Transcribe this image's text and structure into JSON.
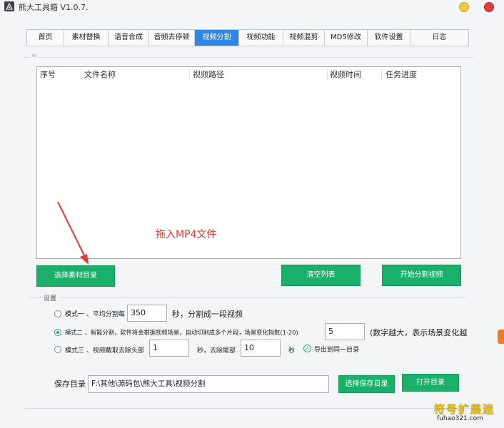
{
  "window": {
    "title": "熊大工具箱 V1.0.7.",
    "min_color": "#f4c542",
    "close_color": "#e23b3b"
  },
  "tabs": [
    {
      "label": "首页"
    },
    {
      "label": "素材替换"
    },
    {
      "label": "语音合成"
    },
    {
      "label": "音频去停顿"
    },
    {
      "label": "视频分割",
      "active": true
    },
    {
      "label": "视频功能"
    },
    {
      "label": "视频混剪"
    },
    {
      "label": "MD5修改"
    },
    {
      "label": "软件设置"
    },
    {
      "label": "日志"
    }
  ],
  "file_group_label": "45",
  "file_list": {
    "columns": [
      "序号",
      "文件名称",
      "视频路径",
      "视频时间",
      "任务进度"
    ],
    "rows": [],
    "drop_hint": "拖入MP4文件"
  },
  "actions": {
    "select_dir": "选择素材目录",
    "clear_list": "清空列表",
    "start_split": "开始分割视频"
  },
  "settings": {
    "label": "设置",
    "mode1": {
      "label": "模式一 、平均分割每",
      "value": "350",
      "suffix": "秒，分割成一段视频",
      "checked": false
    },
    "mode2": {
      "label": "模式二 、智能分割，软件将会根据视频场景，自动切割成多个片段，场景变化指数(1-20)",
      "value": "5",
      "suffix": "(数字越大，表示场景变化越",
      "checked": true
    },
    "mode3": {
      "label": "模式三 、视频截取去除头部",
      "head_value": "1",
      "mid": "秒，去除尾部",
      "tail_value": "10",
      "sec": "秒",
      "export_same": "导出到同一目录",
      "checked": false
    }
  },
  "save": {
    "label": "保存目录",
    "path": "F:\\其他\\源码包\\熊大工具\\视频分割",
    "choose_button": "选择保存目录",
    "open_button": "打开目录"
  },
  "watermark": {
    "text": "符号扩展迷",
    "url": "fuhao321.com"
  },
  "colors": {
    "accent_tab": "#2e87e6",
    "button_green": "#1aaf6a",
    "drop_hint": "#e53935"
  }
}
